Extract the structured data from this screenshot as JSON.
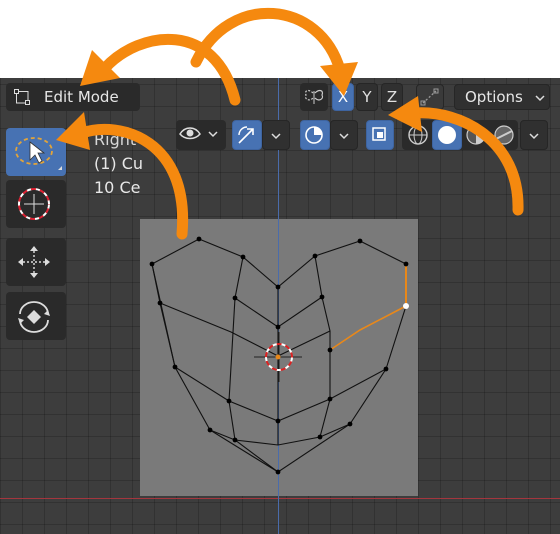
{
  "header": {
    "mode_label": "Edit Mode",
    "options_label": "Options",
    "mirror_axes": [
      {
        "label": "X",
        "active": true
      },
      {
        "label": "Y",
        "active": false
      },
      {
        "label": "Z",
        "active": false
      }
    ]
  },
  "overlay": {
    "line1": "Right",
    "line2": "(1) Cu",
    "line3": "10 Ce"
  },
  "toolbar": {
    "tools": [
      "select-box",
      "cursor",
      "move",
      "rotate"
    ]
  },
  "colors": {
    "accent": "#4772b3",
    "arrow": "#f5890f",
    "x_axis": "#a4363e",
    "y_axis": "#4a6cab",
    "selected_edge": "#e8881a"
  }
}
